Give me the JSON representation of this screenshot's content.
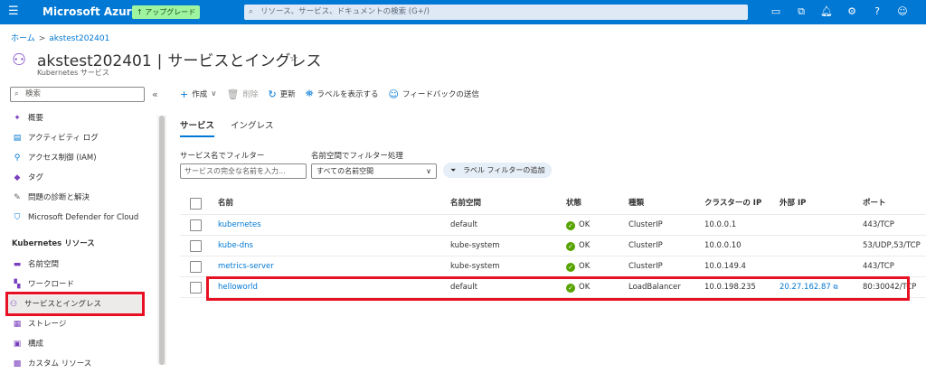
{
  "topbar": {
    "brand": "Microsoft Azure",
    "upgrade_label": "アップグレード",
    "search_placeholder": "リソース、サービス、ドキュメントの検索 (G+/)"
  },
  "breadcrumb": {
    "home": "ホーム",
    "current": "akstest202401"
  },
  "header": {
    "resource_name": "akstest202401",
    "page_name": "サービスとイングレス",
    "subtitle": "Kubernetes サービス"
  },
  "sidebar": {
    "search_placeholder": "検索",
    "items": [
      {
        "label": "概要",
        "icon": "overview-icon"
      },
      {
        "label": "アクティビティ ログ",
        "icon": "activity-log-icon"
      },
      {
        "label": "アクセス制御 (IAM)",
        "icon": "iam-icon"
      },
      {
        "label": "タグ",
        "icon": "tag-icon"
      },
      {
        "label": "問題の診断と解決",
        "icon": "wrench-icon"
      },
      {
        "label": "Microsoft Defender for Cloud",
        "icon": "shield-icon"
      }
    ],
    "section_title": "Kubernetes リソース",
    "resource_items": [
      {
        "label": "名前空間",
        "icon": "namespace-icon"
      },
      {
        "label": "ワークロード",
        "icon": "workload-icon"
      },
      {
        "label": "サービスとイングレス",
        "icon": "services-icon"
      },
      {
        "label": "ストレージ",
        "icon": "storage-icon"
      },
      {
        "label": "構成",
        "icon": "config-icon"
      },
      {
        "label": "カスタム リソース",
        "icon": "custom-resource-icon"
      }
    ]
  },
  "toolbar": {
    "create": "作成",
    "delete": "削除",
    "refresh": "更新",
    "show_labels": "ラベルを表示する",
    "feedback": "フィードバックの送信"
  },
  "tabs": [
    "サービス",
    "イングレス"
  ],
  "filters": {
    "name_label": "サービス名でフィルター",
    "name_placeholder": "サービスの完全な名前を入力...",
    "ns_label": "名前空間でフィルター処理",
    "ns_value": "すべての名前空間",
    "label_filter": "ラベル フィルターの追加"
  },
  "table": {
    "headers": [
      "名前",
      "名前空間",
      "状態",
      "種類",
      "クラスターの IP",
      "外部 IP",
      "ポート"
    ],
    "rows": [
      {
        "name": "kubernetes",
        "namespace": "default",
        "status": "OK",
        "type": "ClusterIP",
        "cluster_ip": "10.0.0.1",
        "external_ip": "",
        "ports": "443/TCP"
      },
      {
        "name": "kube-dns",
        "namespace": "kube-system",
        "status": "OK",
        "type": "ClusterIP",
        "cluster_ip": "10.0.0.10",
        "external_ip": "",
        "ports": "53/UDP,53/TCP"
      },
      {
        "name": "metrics-server",
        "namespace": "kube-system",
        "status": "OK",
        "type": "ClusterIP",
        "cluster_ip": "10.0.149.4",
        "external_ip": "",
        "ports": "443/TCP"
      },
      {
        "name": "helloworld",
        "namespace": "default",
        "status": "OK",
        "type": "LoadBalancer",
        "cluster_ip": "10.0.198.235",
        "external_ip": "20.27.162.87",
        "ports": "80:30042/TCP"
      }
    ]
  },
  "colors": {
    "accent": "#0078d4",
    "highlight": "#e81123",
    "ok": "#57a300"
  }
}
